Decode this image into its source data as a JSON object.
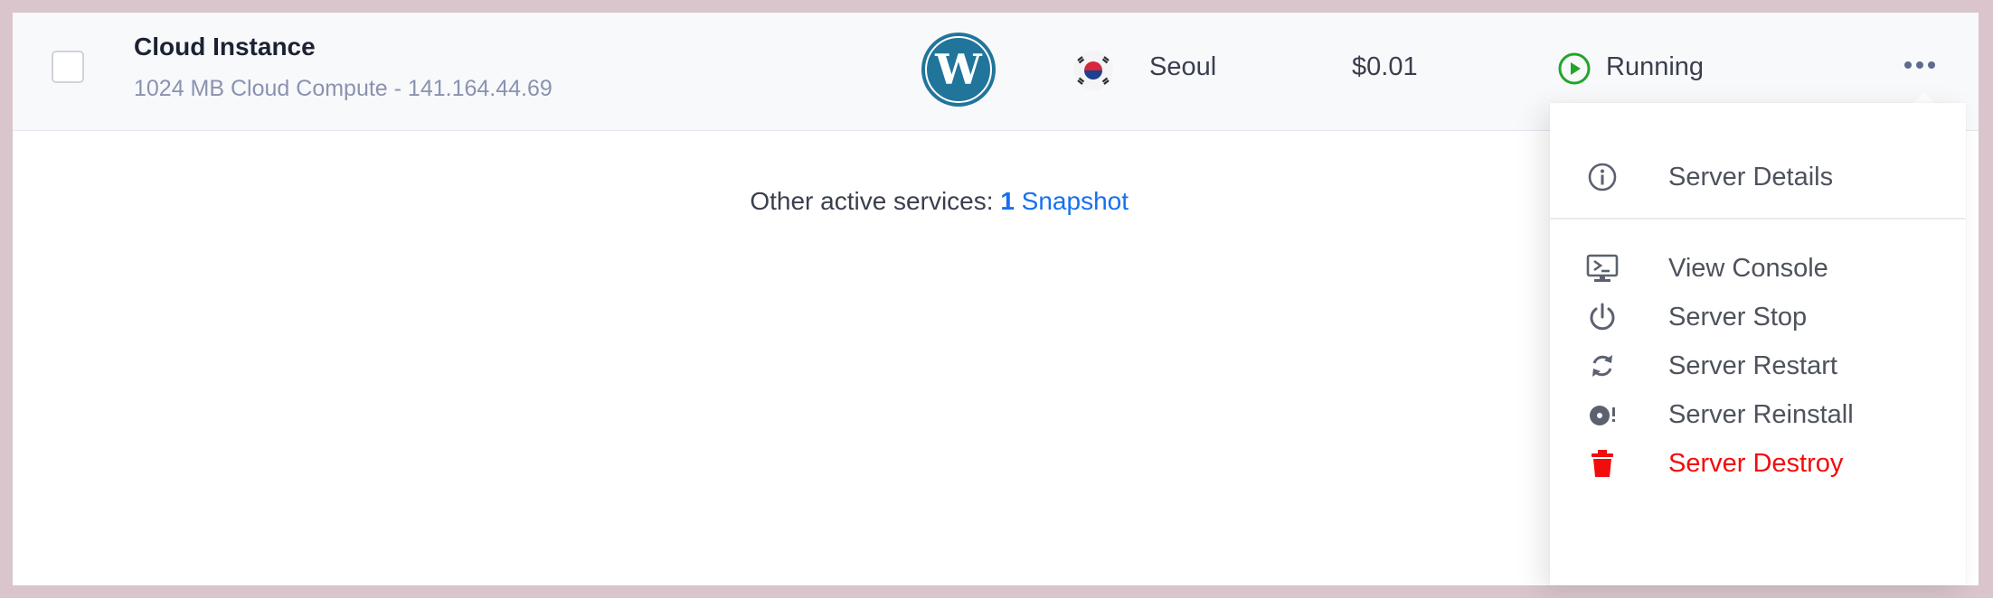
{
  "instance": {
    "title": "Cloud Instance",
    "subtitle": "1024 MB Cloud Compute - 141.164.44.69",
    "app_icon": "wordpress-logo",
    "flag_icon": "south-korea-flag",
    "location": "Seoul",
    "price": "$0.01",
    "status": "Running",
    "status_color": "#22a629"
  },
  "services": {
    "prefix": "Other active services:",
    "count": "1",
    "link": "Snapshot"
  },
  "menu": {
    "items": [
      {
        "label": "Server Details",
        "icon": "info-icon"
      },
      {
        "label": "View Console",
        "icon": "console-icon"
      },
      {
        "label": "Server Stop",
        "icon": "power-icon"
      },
      {
        "label": "Server Restart",
        "icon": "restart-icon"
      },
      {
        "label": "Server Reinstall",
        "icon": "reinstall-icon"
      },
      {
        "label": "Server Destroy",
        "icon": "trash-icon",
        "color": "#f20c0c"
      }
    ]
  },
  "colors": {
    "accent": "#1570ef",
    "wordpress": "#21759b",
    "danger": "#f20c0c"
  }
}
